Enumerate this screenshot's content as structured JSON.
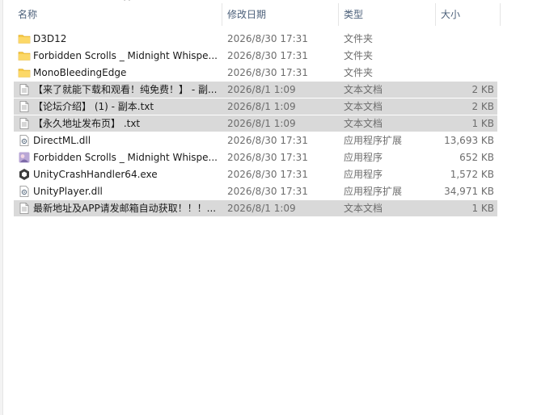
{
  "header": {
    "name": "名称",
    "date": "修改日期",
    "type": "类型",
    "size": "大小",
    "sort_indicator": "^"
  },
  "files": [
    {
      "name": "D3D12",
      "date": "2026/8/30 17:31",
      "type": "文件夹",
      "size": "",
      "icon": "folder-icon",
      "selected": false
    },
    {
      "name": "Forbidden Scrolls _ Midnight Whispe...",
      "date": "2026/8/30 17:31",
      "type": "文件夹",
      "size": "",
      "icon": "folder-icon",
      "selected": false
    },
    {
      "name": "MonoBleedingEdge",
      "date": "2026/8/30 17:31",
      "type": "文件夹",
      "size": "",
      "icon": "folder-icon",
      "selected": false
    },
    {
      "name": "【来了就能下载和观看！纯免费！】 - 副...",
      "date": "2026/8/1 1:09",
      "type": "文本文档",
      "size": "2 KB",
      "icon": "text-document-icon",
      "selected": true
    },
    {
      "name": "【论坛介绍】 (1) - 副本.txt",
      "date": "2026/8/1 1:09",
      "type": "文本文档",
      "size": "2 KB",
      "icon": "text-document-icon",
      "selected": true
    },
    {
      "name": "【永久地址发布页】 .txt",
      "date": "2026/8/1 1:09",
      "type": "文本文档",
      "size": "1 KB",
      "icon": "text-document-icon",
      "selected": true
    },
    {
      "name": "DirectML.dll",
      "date": "2026/8/30 17:31",
      "type": "应用程序扩展",
      "size": "13,693 KB",
      "icon": "dll-icon",
      "selected": false
    },
    {
      "name": "Forbidden Scrolls _ Midnight Whispe...",
      "date": "2026/8/30 17:31",
      "type": "应用程序",
      "size": "652 KB",
      "icon": "game-exe-icon",
      "selected": false
    },
    {
      "name": "UnityCrashHandler64.exe",
      "date": "2026/8/30 17:31",
      "type": "应用程序",
      "size": "1,572 KB",
      "icon": "unity-icon",
      "selected": false
    },
    {
      "name": "UnityPlayer.dll",
      "date": "2026/8/30 17:31",
      "type": "应用程序扩展",
      "size": "34,971 KB",
      "icon": "dll-icon",
      "selected": false
    },
    {
      "name": "最新地址及APP请发邮箱自动获取！！！...",
      "date": "2026/8/1 1:09",
      "type": "文本文档",
      "size": "1 KB",
      "icon": "text-document-icon",
      "selected": true
    }
  ],
  "colors": {
    "selection": "#d9d9d9",
    "folder": "#f6c945",
    "header_text": "#4c607a"
  }
}
